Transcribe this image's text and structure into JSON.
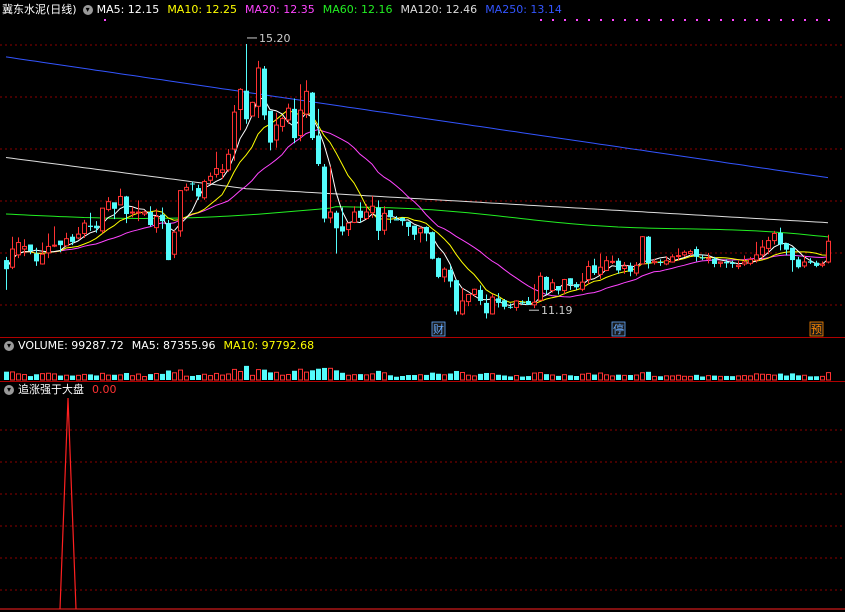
{
  "header": {
    "stock_title": "冀东水泥(日线)",
    "ma": [
      {
        "label": "MA5: 12.15",
        "color": "#ffffff"
      },
      {
        "label": "MA10: 12.25",
        "color": "#ffff00"
      },
      {
        "label": "MA20: 12.35",
        "color": "#ff44ff"
      },
      {
        "label": "MA60: 12.16",
        "color": "#22ee22"
      },
      {
        "label": "MA120: 12.46",
        "color": "#dddddd"
      },
      {
        "label": "MA250: 13.14",
        "color": "#3355ff"
      }
    ]
  },
  "volume_header": {
    "volume": "VOLUME: 99287.72",
    "ma5": "MA5: 87355.96",
    "ma10": "MA10: 97792.68"
  },
  "indicator_header": {
    "name": "追涨强于大盘",
    "value": "0.00"
  },
  "markers": [
    {
      "label": "财",
      "index": 72,
      "color": "#66aaff"
    },
    {
      "label": "停",
      "index": 102,
      "color": "#66aaff"
    },
    {
      "label": "预",
      "index": 135,
      "color": "#ff8800"
    }
  ],
  "colors": {
    "up": "#ff3232",
    "down": "#54fcfc",
    "grid": "#8b0000",
    "divider": "#b00000"
  },
  "chart_data": {
    "type": "candlestick",
    "ylim": [
      10.7,
      15.6
    ],
    "annotations": [
      {
        "text": "15.20",
        "index": 40,
        "value": 15.2
      },
      {
        "text": "11.19",
        "index": 87,
        "value": 11.19
      }
    ],
    "candles": [
      [
        11.87,
        11.73,
        11.92,
        11.41
      ],
      [
        11.76,
        12.04,
        12.23,
        11.73
      ],
      [
        11.95,
        12.14,
        12.22,
        11.9
      ],
      [
        12.04,
        12.08,
        12.19,
        11.93
      ],
      [
        12.11,
        12.01,
        12.08,
        11.96
      ],
      [
        11.97,
        11.85,
        12.06,
        11.78
      ],
      [
        11.81,
        11.96,
        12.14,
        11.8
      ],
      [
        11.98,
        12.08,
        12.28,
        11.9
      ],
      [
        12.1,
        12.1,
        12.39,
        12.07
      ],
      [
        12.17,
        12.1,
        12.16,
        11.99
      ],
      [
        12.09,
        12.2,
        12.29,
        12.09
      ],
      [
        12.23,
        12.15,
        12.27,
        12.1
      ],
      [
        12.21,
        12.27,
        12.38,
        12.19
      ],
      [
        12.28,
        12.44,
        12.49,
        12.21
      ],
      [
        12.4,
        12.38,
        12.6,
        12.32
      ],
      [
        12.4,
        12.36,
        12.47,
        12.29
      ],
      [
        12.32,
        12.67,
        12.67,
        12.28
      ],
      [
        12.65,
        12.77,
        12.84,
        12.62
      ],
      [
        12.76,
        12.66,
        12.75,
        12.5
      ],
      [
        12.72,
        12.85,
        12.97,
        12.73
      ],
      [
        12.85,
        12.58,
        12.86,
        12.44
      ],
      [
        12.6,
        12.61,
        12.69,
        12.53
      ],
      [
        12.61,
        12.61,
        12.79,
        12.47
      ],
      [
        12.58,
        12.61,
        12.63,
        12.55
      ],
      [
        12.61,
        12.41,
        12.7,
        12.39
      ],
      [
        12.37,
        12.54,
        12.66,
        12.29
      ],
      [
        12.57,
        12.47,
        12.68,
        12.35
      ],
      [
        12.44,
        11.87,
        12.49,
        11.87
      ],
      [
        11.96,
        12.3,
        12.33,
        11.9
      ],
      [
        12.32,
        12.94,
        12.95,
        12.23
      ],
      [
        12.95,
        12.99,
        13.05,
        12.93
      ],
      [
        13.05,
        13.04,
        13.08,
        12.94
      ],
      [
        12.98,
        12.85,
        13.03,
        12.8
      ],
      [
        12.83,
        13.08,
        13.11,
        12.8
      ],
      [
        13.1,
        13.16,
        13.22,
        13.04
      ],
      [
        13.19,
        13.28,
        13.54,
        13.14
      ],
      [
        13.22,
        13.26,
        13.35,
        13.12
      ],
      [
        13.26,
        13.5,
        13.58,
        13.23
      ],
      [
        13.58,
        14.15,
        14.26,
        13.4
      ],
      [
        14.19,
        14.5,
        14.52,
        13.87
      ],
      [
        14.48,
        14.04,
        15.2,
        13.97
      ],
      [
        14.09,
        14.3,
        14.31,
        14.09
      ],
      [
        14.24,
        14.83,
        14.94,
        14.06
      ],
      [
        14.82,
        14.1,
        14.86,
        14.03
      ],
      [
        14.17,
        13.68,
        14.08,
        13.56
      ],
      [
        13.72,
        13.95,
        14.14,
        13.6
      ],
      [
        13.93,
        14.05,
        14.08,
        13.85
      ],
      [
        14.03,
        14.21,
        14.28,
        13.97
      ],
      [
        14.2,
        13.75,
        14.36,
        13.67
      ],
      [
        13.79,
        14.18,
        14.58,
        13.7
      ],
      [
        14.12,
        14.47,
        14.64,
        14.06
      ],
      [
        14.45,
        13.75,
        14.46,
        13.72
      ],
      [
        13.79,
        13.35,
        14.2,
        13.32
      ],
      [
        13.31,
        12.51,
        13.35,
        12.45
      ],
      [
        12.52,
        12.61,
        13.31,
        12.44
      ],
      [
        12.6,
        12.36,
        12.63,
        11.97
      ],
      [
        12.39,
        12.31,
        12.68,
        12.25
      ],
      [
        12.34,
        12.44,
        12.44,
        12.24
      ],
      [
        12.45,
        12.61,
        12.7,
        12.44
      ],
      [
        12.63,
        12.52,
        12.76,
        12.45
      ],
      [
        12.51,
        12.61,
        12.73,
        12.49
      ],
      [
        12.6,
        12.7,
        12.86,
        12.52
      ],
      [
        12.68,
        12.32,
        12.79,
        12.18
      ],
      [
        12.33,
        12.59,
        12.7,
        12.26
      ],
      [
        12.64,
        12.53,
        12.64,
        12.44
      ],
      [
        12.5,
        12.48,
        12.55,
        12.49
      ],
      [
        12.52,
        12.47,
        12.53,
        12.4
      ],
      [
        12.46,
        12.38,
        12.46,
        12.24
      ],
      [
        12.4,
        12.26,
        12.4,
        12.18
      ],
      [
        12.29,
        12.36,
        12.39,
        12.14
      ],
      [
        12.38,
        12.28,
        12.39,
        12.16
      ],
      [
        12.3,
        11.89,
        12.31,
        11.88
      ],
      [
        11.9,
        11.61,
        11.91,
        11.59
      ],
      [
        11.61,
        11.73,
        11.76,
        11.53
      ],
      [
        11.72,
        11.54,
        11.79,
        11.45
      ],
      [
        11.56,
        11.08,
        11.57,
        11.03
      ],
      [
        11.04,
        11.24,
        11.44,
        11.02
      ],
      [
        11.23,
        11.34,
        11.35,
        11.16
      ],
      [
        11.34,
        11.42,
        11.43,
        11.3
      ],
      [
        11.41,
        11.24,
        11.48,
        11.18
      ],
      [
        11.21,
        11.05,
        11.34,
        10.97
      ],
      [
        11.04,
        11.3,
        11.35,
        11.03
      ],
      [
        11.28,
        11.21,
        11.36,
        11.14
      ],
      [
        11.25,
        11.15,
        11.27,
        11.11
      ],
      [
        11.15,
        11.14,
        11.2,
        11.12
      ],
      [
        11.14,
        11.24,
        11.25,
        11.09
      ],
      [
        11.22,
        11.21,
        11.25,
        11.18
      ],
      [
        11.24,
        11.18,
        11.3,
        11.19
      ],
      [
        11.18,
        11.22,
        11.5,
        11.13
      ],
      [
        11.25,
        11.62,
        11.68,
        11.26
      ],
      [
        11.61,
        11.41,
        11.62,
        11.34
      ],
      [
        11.4,
        11.52,
        11.58,
        11.37
      ],
      [
        11.47,
        11.4,
        11.47,
        11.34
      ],
      [
        11.4,
        11.57,
        11.58,
        11.34
      ],
      [
        11.59,
        11.49,
        11.59,
        11.41
      ],
      [
        11.5,
        11.45,
        11.53,
        11.41
      ],
      [
        11.42,
        11.53,
        11.67,
        11.39
      ],
      [
        11.57,
        11.77,
        11.86,
        11.5
      ],
      [
        11.79,
        11.67,
        11.89,
        11.64
      ],
      [
        11.65,
        11.76,
        11.97,
        11.58
      ],
      [
        11.71,
        11.86,
        11.93,
        11.7
      ],
      [
        11.85,
        11.85,
        11.94,
        11.81
      ],
      [
        11.86,
        11.71,
        11.9,
        11.66
      ],
      [
        11.74,
        11.78,
        11.84,
        11.66
      ],
      [
        11.78,
        11.69,
        11.83,
        11.62
      ],
      [
        11.67,
        11.79,
        11.84,
        11.63
      ],
      [
        11.81,
        12.23,
        12.24,
        11.81
      ],
      [
        12.23,
        11.82,
        12.24,
        11.74
      ],
      [
        11.83,
        11.85,
        11.89,
        11.8
      ],
      [
        11.84,
        11.83,
        11.88,
        11.78
      ],
      [
        11.81,
        11.86,
        11.93,
        11.79
      ],
      [
        11.84,
        11.92,
        11.96,
        11.83
      ],
      [
        11.93,
        11.94,
        12.05,
        11.86
      ],
      [
        11.95,
        11.99,
        12.02,
        11.92
      ],
      [
        11.97,
        12.0,
        12.03,
        11.94
      ],
      [
        12.04,
        11.92,
        12.08,
        11.85
      ],
      [
        11.91,
        11.9,
        11.95,
        11.87
      ],
      [
        11.89,
        11.9,
        11.98,
        11.82
      ],
      [
        11.89,
        11.81,
        11.92,
        11.76
      ],
      [
        11.82,
        11.84,
        11.85,
        11.76
      ],
      [
        11.84,
        11.82,
        11.88,
        11.75
      ],
      [
        11.83,
        11.81,
        11.86,
        11.75
      ],
      [
        11.77,
        11.79,
        11.86,
        11.73
      ],
      [
        11.81,
        11.84,
        11.94,
        11.78
      ],
      [
        11.82,
        11.88,
        11.92,
        11.79
      ],
      [
        11.87,
        11.95,
        12.15,
        11.83
      ],
      [
        11.95,
        12.07,
        12.18,
        11.89
      ],
      [
        12.05,
        12.17,
        12.23,
        11.96
      ],
      [
        12.17,
        12.28,
        12.32,
        12.11
      ],
      [
        12.29,
        12.11,
        12.37,
        12.02
      ],
      [
        12.13,
        12.03,
        12.11,
        11.94
      ],
      [
        12.06,
        11.87,
        12.05,
        11.69
      ],
      [
        11.88,
        11.76,
        11.92,
        11.74
      ],
      [
        11.78,
        11.84,
        11.94,
        11.75
      ],
      [
        11.85,
        11.83,
        11.9,
        11.81
      ],
      [
        11.83,
        11.78,
        11.86,
        11.76
      ],
      [
        11.79,
        11.81,
        11.85,
        11.76
      ],
      [
        11.84,
        12.16,
        12.26,
        11.82
      ]
    ],
    "volume": {
      "ylim": [
        0,
        320000
      ]
    },
    "indicator": {
      "spike_index": 10,
      "spike_value": 1
    }
  }
}
